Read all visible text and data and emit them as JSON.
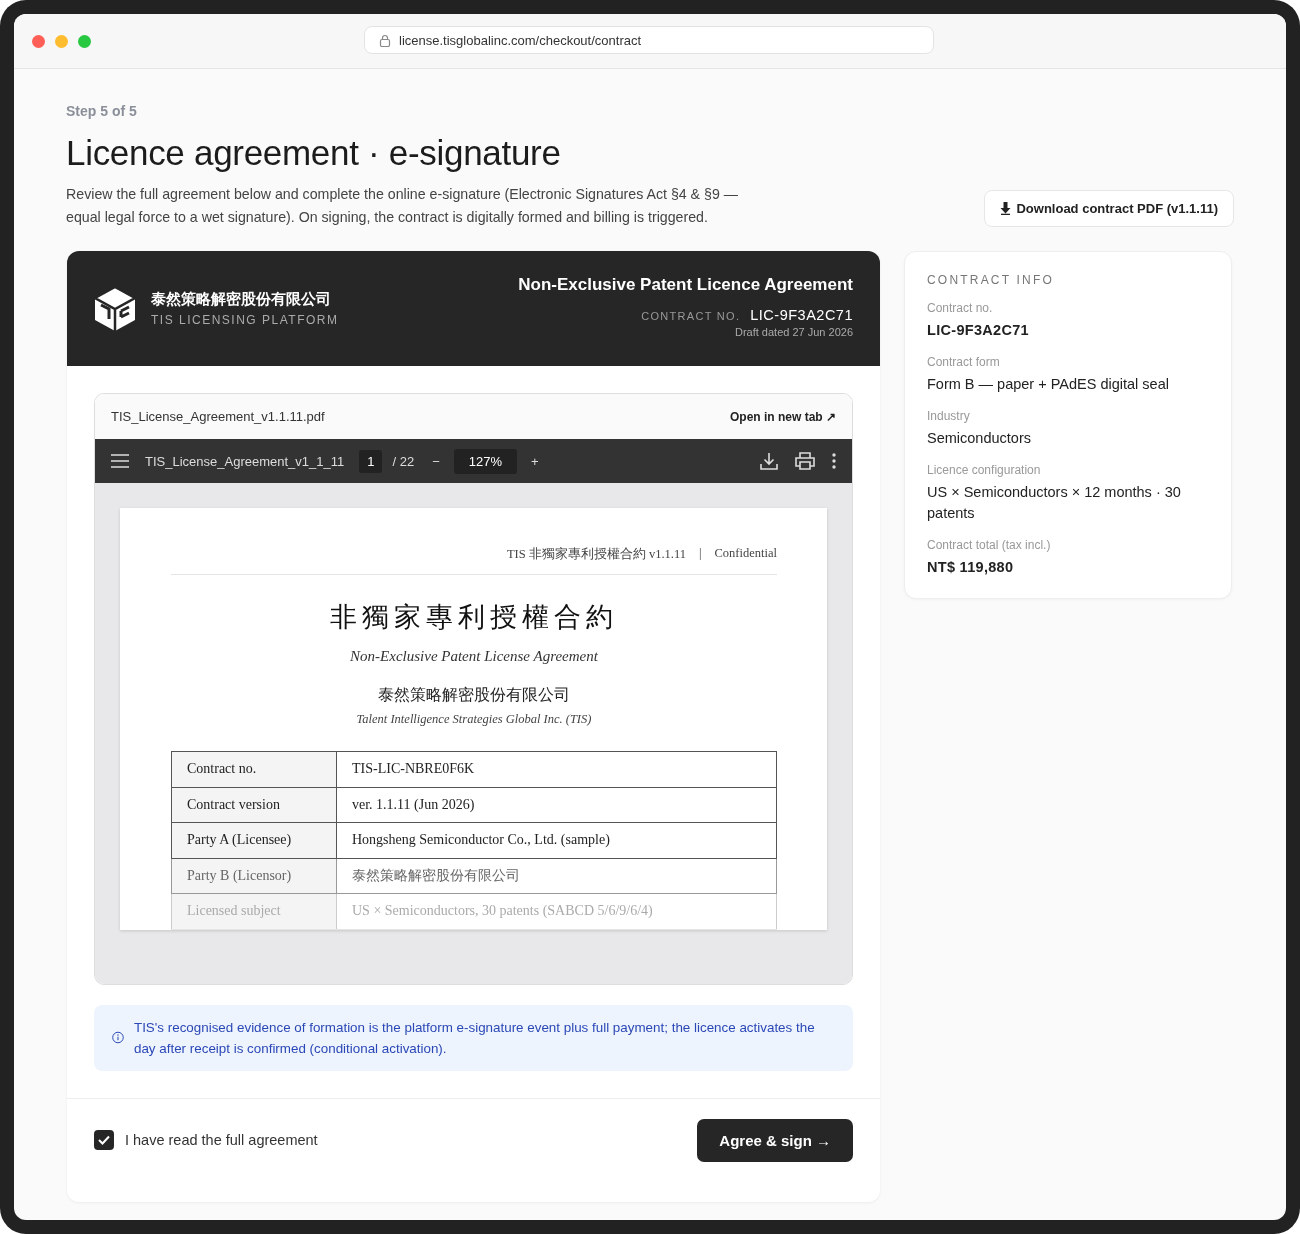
{
  "browser": {
    "url": "license.tisglobalinc.com/checkout/contract"
  },
  "header": {
    "step": "Step 5 of 5",
    "title": "Licence agreement · e-signature",
    "description": "Review the full agreement below and complete the online e-signature (Electronic Signatures Act §4 & §9 — equal legal force to a wet signature). On signing, the contract is digitally formed and billing is triggered.",
    "download_button": "Download contract PDF (v1.1.11)"
  },
  "contract_card": {
    "company_name": "泰然策略解密股份有限公司",
    "platform_label": "TIS LICENSING PLATFORM",
    "agreement_title": "Non-Exclusive Patent Licence Agreement",
    "contract_no_label": "CONTRACT NO.",
    "contract_no": "LIC-9F3A2C71",
    "draft_date": "Draft dated 27 Jun 2026"
  },
  "pdf_viewer": {
    "file_name": "TIS_License_Agreement_v1.1.11.pdf",
    "open_link": "Open in new tab ↗",
    "toolbar": {
      "doc_name": "TIS_License_Agreement_v1_1_11",
      "page": "1",
      "page_count": "/ 22",
      "zoom_out": "−",
      "zoom": "127%",
      "zoom_in": "+"
    },
    "document": {
      "running_header": "TIS 非獨家專利授權合約 v1.1.11",
      "separator": "|",
      "confidential": "Confidential",
      "title_zh": "非獨家專利授權合約",
      "title_en": "Non-Exclusive Patent License Agreement",
      "company_zh": "泰然策略解密股份有限公司",
      "company_en": "Talent Intelligence Strategies Global Inc. (TIS)",
      "rows": [
        {
          "label": "Contract no.",
          "value": "TIS-LIC-NBRE0F6K"
        },
        {
          "label": "Contract version",
          "value": "ver. 1.1.11 (Jun 2026)"
        },
        {
          "label": "Party A (Licensee)",
          "value": "Hongsheng Semiconductor Co., Ltd. (sample)"
        },
        {
          "label": "Party B (Licensor)",
          "value": "泰然策略解密股份有限公司"
        },
        {
          "label": "Licensed subject",
          "value": "US × Semiconductors, 30 patents (SABCD 5/6/9/6/4)"
        }
      ]
    }
  },
  "notice": "TIS's recognised evidence of formation is the platform e-signature event plus full payment; the licence activates the day after receipt is confirmed (conditional activation).",
  "agreement_checkbox": {
    "label": "I have read the full agreement",
    "checked": true
  },
  "sign_button": "Agree & sign →",
  "contract_info": {
    "heading": "CONTRACT INFO",
    "fields": [
      {
        "label": "Contract no.",
        "value": "LIC-9F3A2C71",
        "emphasis": true
      },
      {
        "label": "Contract form",
        "value": "Form B — paper + PAdES digital seal",
        "emphasis": false
      },
      {
        "label": "Industry",
        "value": "Semiconductors",
        "emphasis": false
      },
      {
        "label": "Licence configuration",
        "value": "US × Semiconductors × 12 months · 30 patents",
        "emphasis": false
      },
      {
        "label": "Contract total (tax incl.)",
        "value": "NT$ 119,880",
        "emphasis": true
      }
    ]
  }
}
